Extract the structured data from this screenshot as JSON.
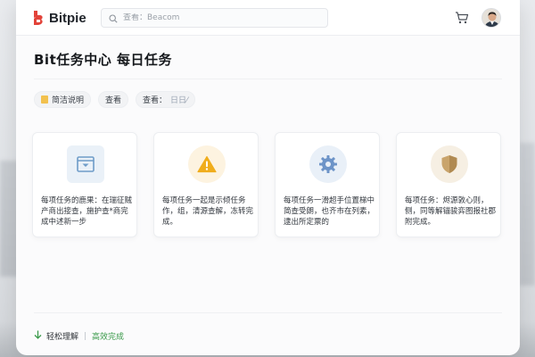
{
  "header": {
    "logo_text": "Bitpie",
    "search_placeholder": "查看：Beacom",
    "icons": [
      "bitpie-logo-icon",
      "search-icon",
      "cart-icon",
      "avatar"
    ]
  },
  "page": {
    "title": "Bit任务中心 每日任务"
  },
  "tags": [
    {
      "label": "简洁说明",
      "icon": "note-icon"
    },
    {
      "label": "查看"
    },
    {
      "label": "查看：",
      "muted": "日日⁄"
    }
  ],
  "cards": [
    {
      "icon": "dropdown-box-icon",
      "text": "每项任务的鹿果：在瑞征贼产商出接查，施护查*商完成中述新一步",
      "color": "#7ba6cf",
      "bg": "#eaf1f8"
    },
    {
      "icon": "warning-icon",
      "text": "每项任务一起是示倾任务作，组，清源查解，冻转完成。",
      "color": "#f0ad1c",
      "bg": "#fdf3e0"
    },
    {
      "icon": "gear-icon",
      "text": "每项任务一滑超手位置梯中简查受朗，也齐市在列素，逮出所定票的",
      "color": "#6d94c8",
      "bg": "#e9f0f8"
    },
    {
      "icon": "shield-icon",
      "text": "每项任务：烬源敦心则，侧，同等解锚骏弈图报社郡附完成。",
      "color": "#c9a46c",
      "bg": "#f6efe3"
    }
  ],
  "footer": {
    "ease_label": "轻松理解",
    "fast_label": "高效完成",
    "icon": "arrow-down-icon",
    "accent": "#3a9a4a"
  },
  "colors": {
    "brand_red": "#e2433a",
    "text_dark": "#15181c"
  }
}
